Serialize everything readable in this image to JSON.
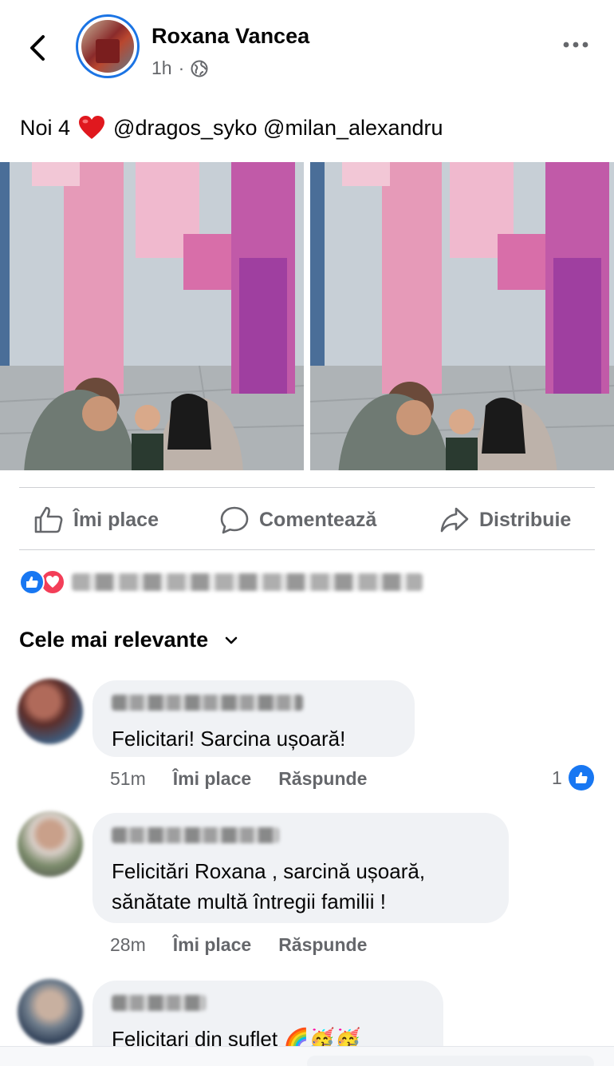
{
  "header": {
    "author": "Roxana Vancea",
    "time": "1h",
    "dot": "·",
    "icons": [
      "back-icon",
      "globe-icon",
      "more-icon"
    ]
  },
  "post": {
    "caption_prefix": "Noi 4",
    "caption_mentions": "@dragos_syko @milan_alexandru",
    "photos": 2
  },
  "actions": {
    "like": "Îmi place",
    "comment": "Comentează",
    "share": "Distribuie"
  },
  "sort": {
    "label": "Cele mai relevante"
  },
  "comments": [
    {
      "text": "Felicitari! Sarcina ușoară!",
      "time": "51m",
      "like": "Îmi place",
      "reply": "Răspunde",
      "reactions": "1"
    },
    {
      "text": "Felicitări Roxana , sarcină ușoară,\nsănătate multă întregii familii !",
      "time": "28m",
      "like": "Îmi place",
      "reply": "Răspunde"
    },
    {
      "text": "Felicitari din suflet 🌈🥳🥳"
    }
  ],
  "colors": {
    "accent": "#1877f2",
    "love": "#f33e58",
    "secondary_text": "#65676b",
    "bubble": "#f0f2f5"
  }
}
